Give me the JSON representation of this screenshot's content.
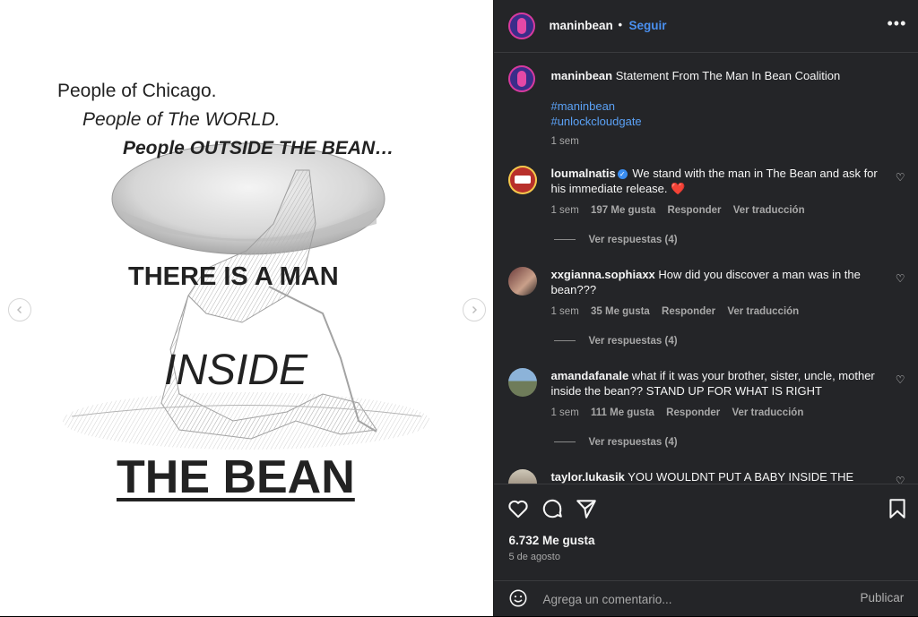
{
  "post_image": {
    "lines": [
      "People of Chicago.",
      "People of The WORLD.",
      "People OUTSIDE THE BEAN…",
      "THERE IS A MAN",
      "INSIDE",
      "THE BEAN"
    ]
  },
  "header": {
    "username": "maninbean",
    "separator": "•",
    "follow_label": "Seguir",
    "more_icon": "more-horizontal-icon"
  },
  "caption": {
    "username": "maninbean",
    "text": "Statement From The Man In Bean Coalition",
    "hashtags": [
      "#maninbean",
      "#unlockcloudgate"
    ],
    "time": "1 sem"
  },
  "comments": [
    {
      "username": "loumalnatis",
      "verified": true,
      "text": "We stand with the man in The Bean and ask for his immediate release. ❤️",
      "time": "1 sem",
      "likes": "197 Me gusta",
      "reply_label": "Responder",
      "translate_label": "Ver traducción",
      "replies_label": "Ver respuestas (4)"
    },
    {
      "username": "xxgianna.sophiaxx",
      "text": "How did you discover a man was in the bean???",
      "time": "1 sem",
      "likes": "35 Me gusta",
      "reply_label": "Responder",
      "translate_label": "Ver traducción",
      "replies_label": "Ver respuestas (4)"
    },
    {
      "username": "amandafanale",
      "text": "what if it was your brother, sister, uncle, mother inside the bean?? STAND UP FOR WHAT IS RIGHT",
      "time": "1 sem",
      "likes": "111 Me gusta",
      "reply_label": "Responder",
      "translate_label": "Ver traducción",
      "replies_label": "Ver respuestas (4)"
    },
    {
      "username": "taylor.lukasik",
      "text": "YOU WOULDNT PUT A BABY INSIDE THE"
    }
  ],
  "actions": {
    "like_count": "6.732 Me gusta",
    "date": "5 de agosto"
  },
  "composer": {
    "placeholder": "Agrega un comentario...",
    "publish_label": "Publicar"
  },
  "colors": {
    "panel_bg": "#242528",
    "link_blue": "#4a90f0",
    "heart_red": "#e0245e"
  }
}
